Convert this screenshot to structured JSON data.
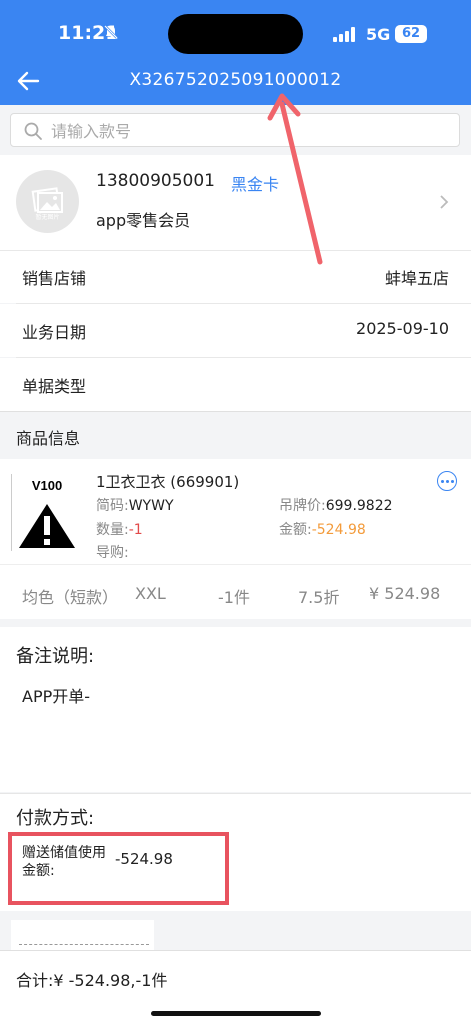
{
  "status_bar": {
    "time": "11:21",
    "network": "5G",
    "battery": "62"
  },
  "nav": {
    "title": "X326752025091000012"
  },
  "search": {
    "placeholder": "请输入款号"
  },
  "member": {
    "avatar_text": "暂无图片",
    "phone": "13800905001",
    "level": "黑金卡",
    "type": "app零售会员"
  },
  "info_rows": [
    {
      "label": "销售店铺",
      "value": "蚌埠五店"
    },
    {
      "label": "业务日期",
      "value": "2025-09-10"
    },
    {
      "label": "单据类型",
      "value": ""
    }
  ],
  "goods_section": {
    "title": "商品信息"
  },
  "product": {
    "thumb_label": "V100",
    "name": "1卫衣卫衣 (669901)",
    "code_label": "简码:",
    "code": "WYWY",
    "tag_price_label": "吊牌价:",
    "tag_price": "699.9822",
    "qty_label": "数量:",
    "qty": "-1",
    "amount_label": "金额:",
    "amount": "-524.98",
    "guide_label": "导购:",
    "guide": ""
  },
  "spec": {
    "color": "均色（短款）",
    "size": "XXL",
    "count": "-1件",
    "discount": "7.5折",
    "price": "¥ 524.98"
  },
  "notes": {
    "title": "备注说明:",
    "text": "APP开单-"
  },
  "payment": {
    "title": "付款方式:",
    "label": "赠送储值使用金额:",
    "value": "-524.98"
  },
  "footer": {
    "summary": "合计:¥ -524.98,-1件"
  },
  "colors": {
    "primary": "#3a85f2",
    "highlight_box": "#e8535f",
    "annotation_arrow": "#f0646b",
    "negative": "#e24a4a",
    "amount": "#f39b3b"
  },
  "icons": [
    "bell-slash-icon",
    "signal-icon",
    "battery-icon",
    "back-arrow-icon",
    "search-icon",
    "chevron-right-icon",
    "more-icon",
    "warning-icon"
  ]
}
